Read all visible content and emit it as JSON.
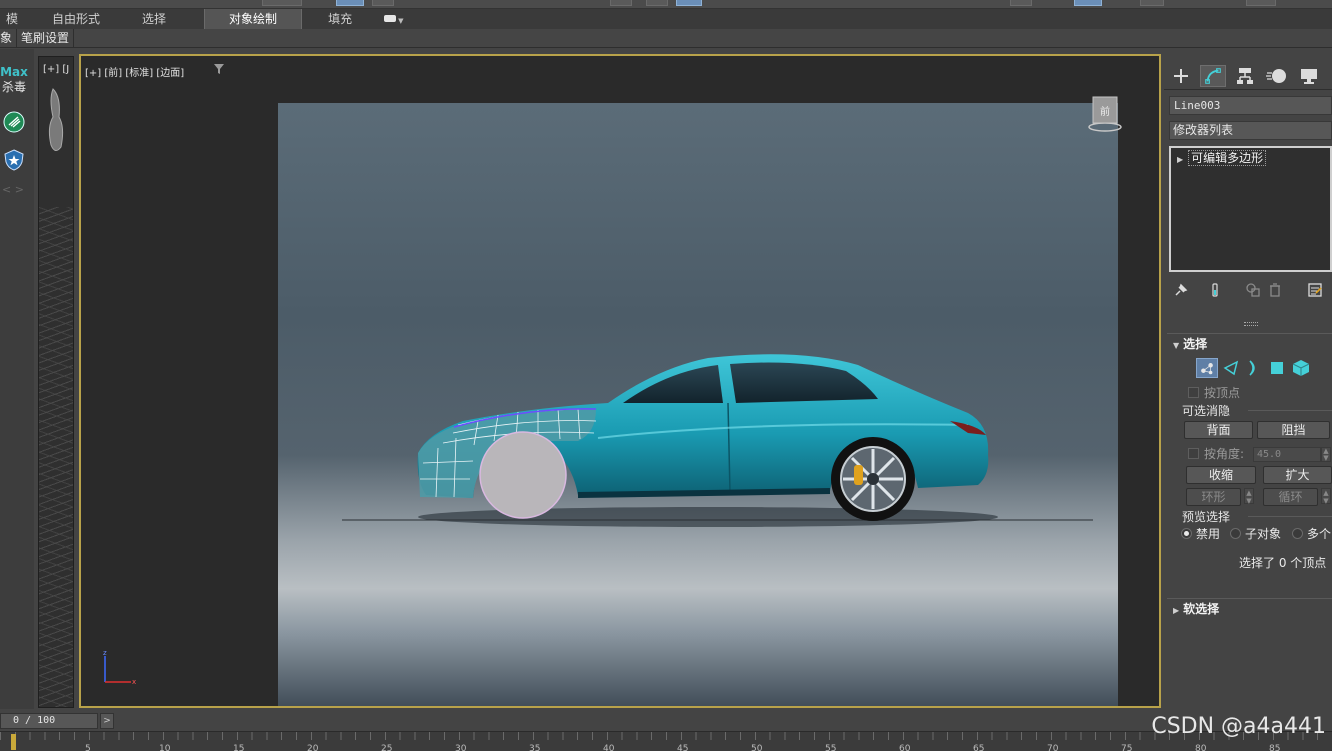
{
  "ribbon": {
    "tabs": [
      "模",
      "自由形式",
      "选择",
      "对象绘制",
      "填充"
    ],
    "active_tab": "对象绘制"
  },
  "sub_tabs": [
    "象",
    "笔刷设置"
  ],
  "left_strip": {
    "badge_line1": "Max",
    "badge_line2": "杀毒",
    "icons": [
      "antivirus-icon",
      "shield-icon"
    ],
    "thumb_viewport_label": "[+] [J"
  },
  "viewport": {
    "label": "[+] [前] [标准] [边面]",
    "filter_icon": "filter-icon",
    "viewcube_label": "前",
    "border_color": "#b8a24a"
  },
  "command_panel": {
    "tabs": [
      "create-icon",
      "modify-icon",
      "hierarchy-icon",
      "motion-icon",
      "display-icon"
    ],
    "active_tab": "modify-icon",
    "object_name": "Line003",
    "modifier_list": "修改器列表",
    "stack_items": [
      {
        "label": "可编辑多边形"
      }
    ],
    "stack_tools": [
      "pin-stack-icon",
      "show-end-result-icon",
      "make-unique-icon",
      "remove-modifier-icon",
      "configure-sets-icon"
    ],
    "selection_rollout": {
      "title": "选择",
      "subobject_icons": [
        "vertex-icon",
        "edge-icon",
        "border-icon",
        "polygon-icon",
        "element-icon"
      ],
      "active_subobject": "vertex-icon",
      "by_vertex": "按顶点",
      "ignore_group": "可选消隐",
      "backface_button": "背面",
      "occluded_button": "阻挡",
      "by_angle": "按角度:",
      "angle_value": "45.0",
      "shrink_button": "收缩",
      "grow_button": "扩大",
      "ring_button": "环形",
      "loop_button": "循环",
      "preview_group": "预览选择",
      "preview_options": [
        "禁用",
        "子对象",
        "多个"
      ],
      "preview_selected": "禁用",
      "status": "选择了 0 个顶点"
    },
    "soft_selection_title": "软选择"
  },
  "timeline": {
    "frame_display": "0 / 100",
    "ruler_numbers": [
      "5",
      "10",
      "15",
      "20",
      "25",
      "30",
      "35",
      "40",
      "45",
      "50",
      "55",
      "60",
      "65",
      "70",
      "75",
      "80",
      "85"
    ]
  },
  "watermark": "CSDN @a4a441",
  "colors": {
    "accent": "#3fc1c9",
    "car": "#1e9fb5",
    "selection_highlight": "#5f7fa6"
  }
}
